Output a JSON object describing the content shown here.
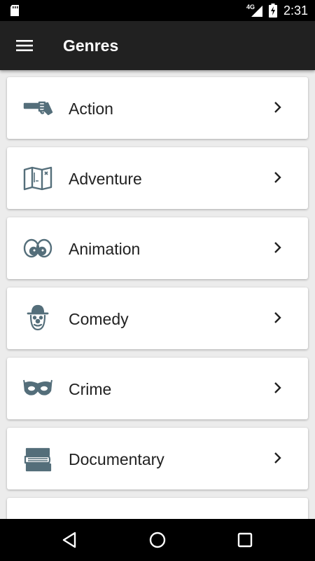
{
  "status_bar": {
    "network": "4G",
    "time": "2:31"
  },
  "app_bar": {
    "title": "Genres"
  },
  "genres": [
    {
      "label": "Action",
      "icon": "revolver-icon"
    },
    {
      "label": "Adventure",
      "icon": "map-icon"
    },
    {
      "label": "Animation",
      "icon": "cartoon-eyes-icon"
    },
    {
      "label": "Comedy",
      "icon": "clown-icon"
    },
    {
      "label": "Crime",
      "icon": "mask-icon"
    },
    {
      "label": "Documentary",
      "icon": "books-icon"
    },
    {
      "label": "",
      "icon": "partial-icon"
    }
  ],
  "colors": {
    "app_bar": "#212121",
    "background": "#ececec",
    "icon": "#546e7a",
    "status_bar": "#000000"
  }
}
